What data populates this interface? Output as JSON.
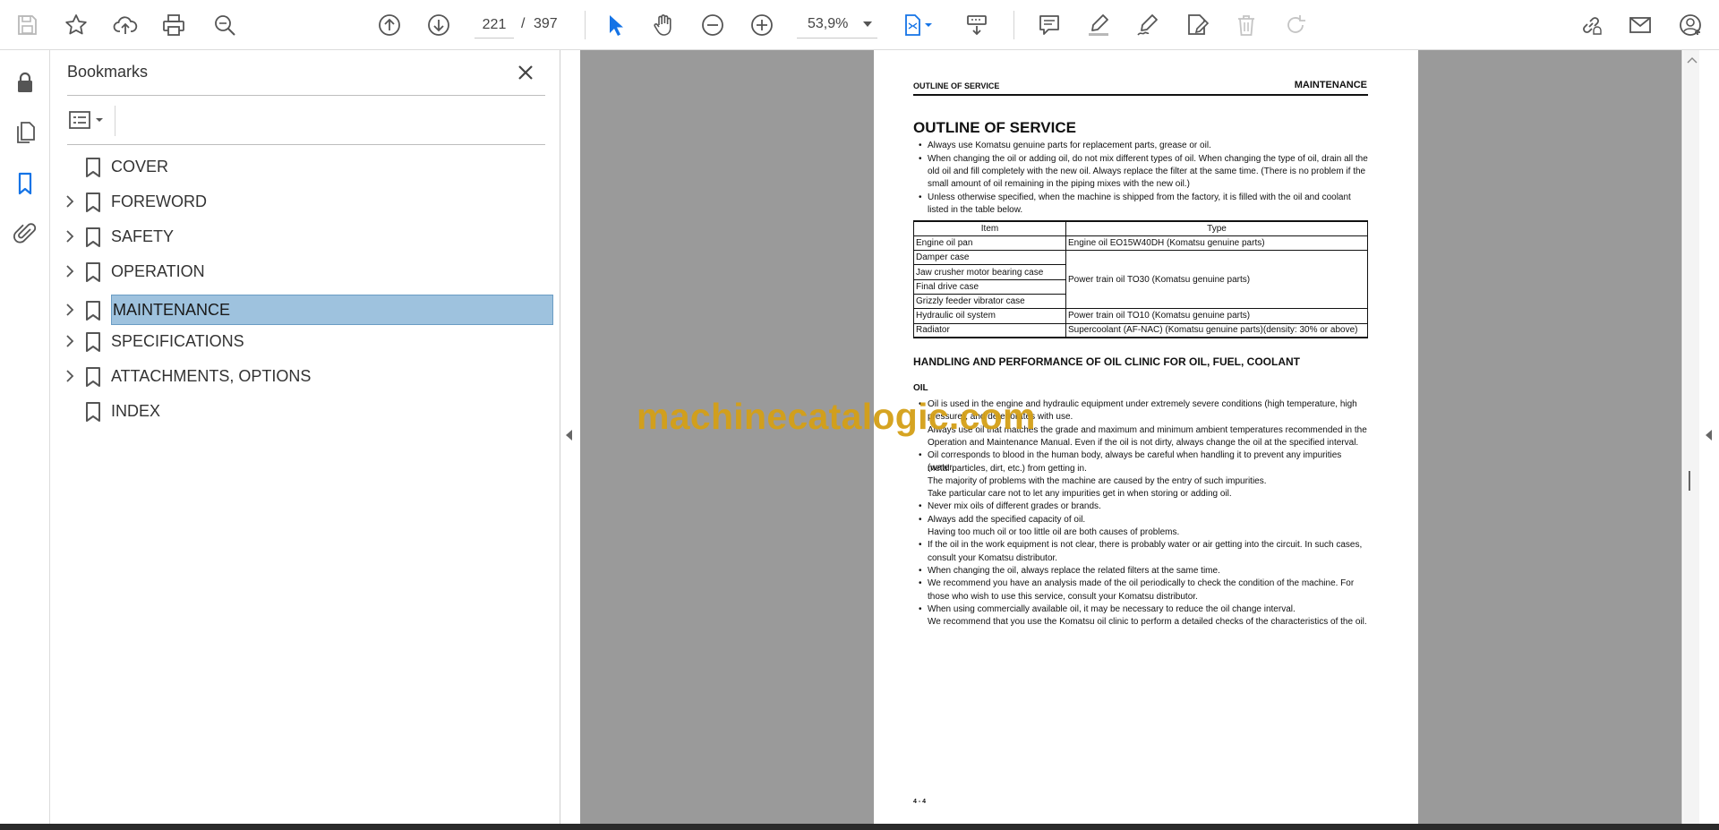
{
  "toolbar": {
    "page_current": "221",
    "page_separator": "/",
    "page_total": "397",
    "zoom": "53,9%",
    "icons": [
      "save-icon",
      "star-icon",
      "upload-cloud-icon",
      "print-icon",
      "zoom-search-icon",
      "page-up-icon",
      "page-down-icon",
      "select-cursor-icon",
      "hand-icon",
      "zoom-out-icon",
      "zoom-in-icon",
      "fit-page-icon",
      "scroll-mode-icon",
      "comment-icon",
      "highlight-icon",
      "sign-icon",
      "fill-sign-icon",
      "delete-icon",
      "redo-icon",
      "share-link-icon",
      "email-icon",
      "user-add-icon"
    ]
  },
  "left_rail": {
    "icons": [
      "lock-icon",
      "pages-icon",
      "bookmark-icon",
      "attachment-icon"
    ]
  },
  "bookmarks": {
    "title": "Bookmarks",
    "items": [
      {
        "label": "COVER",
        "expandable": false,
        "selected": false
      },
      {
        "label": "FOREWORD",
        "expandable": true,
        "selected": false
      },
      {
        "label": "SAFETY",
        "expandable": true,
        "selected": false
      },
      {
        "label": "OPERATION",
        "expandable": true,
        "selected": false
      },
      {
        "label": "MAINTENANCE",
        "expandable": true,
        "selected": true
      },
      {
        "label": "SPECIFICATIONS",
        "expandable": true,
        "selected": false
      },
      {
        "label": "ATTACHMENTS, OPTIONS",
        "expandable": true,
        "selected": false
      },
      {
        "label": "INDEX",
        "expandable": false,
        "selected": false
      }
    ]
  },
  "document": {
    "header_left": "OUTLINE OF SERVICE",
    "header_right": "MAINTENANCE",
    "title": "OUTLINE OF SERVICE",
    "bullets": [
      "Always use Komatsu genuine parts for replacement parts, grease or oil.",
      "When changing the oil or adding oil, do not mix different types of oil. When changing the type of oil, drain all the old oil and fill completely with the new oil. Always replace the filter at the same time. (There is no problem if the small amount of oil remaining in the piping mixes with the new oil.)",
      "Unless otherwise specified, when the machine is shipped from the factory, it is filled with the oil and coolant listed in the table below."
    ],
    "table": {
      "headers": [
        "Item",
        "Type"
      ],
      "rows": [
        [
          "Engine oil pan",
          "Engine oil EO15W40DH (Komatsu genuine parts)"
        ],
        [
          "Damper case",
          ""
        ],
        [
          "Jaw crusher motor bearing case",
          "Power train oil TO30 (Komatsu genuine parts)"
        ],
        [
          "Final drive case",
          ""
        ],
        [
          "Grizzly feeder vibrator case",
          ""
        ],
        [
          "Hydraulic oil system",
          "Power train oil TO10 (Komatsu genuine parts)"
        ],
        [
          "Radiator",
          "Supercoolant (AF-NAC) (Komatsu genuine parts)(density: 30% or above)"
        ]
      ]
    },
    "handling_title": "HANDLING AND PERFORMANCE OF OIL CLINIC FOR OIL, FUEL, COOLANT",
    "oil_title": "OIL",
    "oil_lines": [
      {
        "bullet": true,
        "text": "Oil is used in the engine and hydraulic equipment under extremely severe conditions (high temperature, high"
      },
      {
        "bullet": false,
        "text": "pressure), and deteriorates with use."
      },
      {
        "bullet": false,
        "text": "Always use oil that matches the grade and maximum and minimum ambient temperatures recommended in the"
      },
      {
        "bullet": false,
        "text": "Operation and Maintenance Manual.  Even if the oil is not dirty, always change the oil at the specified interval."
      },
      {
        "bullet": true,
        "text": "Oil corresponds to blood in the human body, always be careful when handling it to prevent any impurities (water,"
      },
      {
        "bullet": false,
        "text": "metal particles, dirt, etc.) from getting in."
      },
      {
        "bullet": false,
        "text": "The majority of problems with the machine are caused by the entry of such impurities."
      },
      {
        "bullet": false,
        "text": "Take particular care not to let any impurities get in when storing or adding oil."
      },
      {
        "bullet": true,
        "text": "Never mix oils of different grades or brands."
      },
      {
        "bullet": true,
        "text": "Always add the specified capacity of oil."
      },
      {
        "bullet": false,
        "text": "Having too much oil or too little oil are both causes of problems."
      },
      {
        "bullet": true,
        "text": "If the oil in the work equipment is not clear, there is probably water or air getting into the circuit. In such cases,"
      },
      {
        "bullet": false,
        "text": "consult your Komatsu distributor."
      },
      {
        "bullet": true,
        "text": "When changing the oil, always replace the related filters at the same time."
      },
      {
        "bullet": true,
        "text": "We recommend you have an analysis made of the oil periodically to check the condition of the machine.  For"
      },
      {
        "bullet": false,
        "text": "those who wish to use this service, consult your Komatsu distributor."
      },
      {
        "bullet": true,
        "text": "When using commercially available oil, it may be necessary to reduce the oil change interval."
      },
      {
        "bullet": false,
        "text": "We recommend that you use the Komatsu oil clinic to perform a detailed checks of the characteristics of the oil."
      }
    ],
    "page_number": "4 - 4"
  },
  "watermark": "machinecatalogic.com",
  "colors": {
    "accent_blue": "#1473e6",
    "selection": "#9ec2de",
    "watermark": "#d4a017",
    "doc_background": "#9a9a9a"
  }
}
